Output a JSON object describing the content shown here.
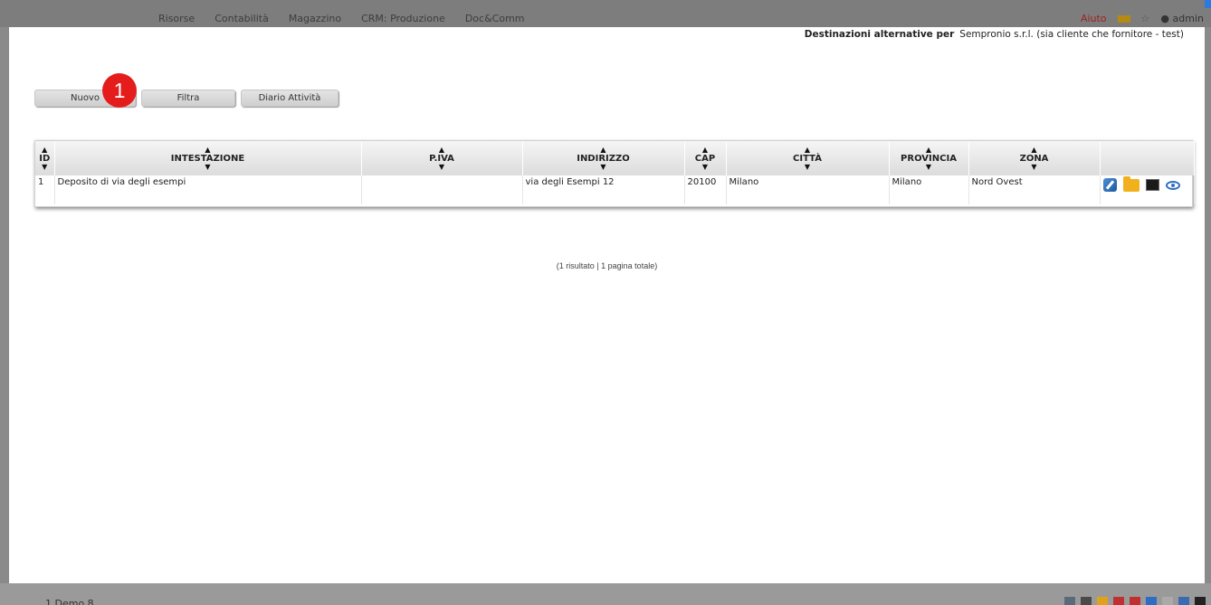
{
  "background": {
    "menu": [
      "Risorse",
      "Contabilità",
      "Magazzino",
      "CRM: Produzione",
      "Doc&Comm"
    ],
    "help": "Aiuto",
    "user": "admin",
    "bottom_text": "1   Demo 8"
  },
  "dialog": {
    "title_label": "Destinazioni alternative per",
    "title_value": "Sempronio s.r.l. (sia cliente che fornitore - test)"
  },
  "toolbar": {
    "nuovo": "Nuovo",
    "filtra": "Filtra",
    "diario": "Diario Attività"
  },
  "badge": "1",
  "table": {
    "columns": [
      "ID",
      "INTESTAZIONE",
      "P.IVA",
      "INDIRIZZO",
      "CAP",
      "CITTÀ",
      "PROVINCIA",
      "ZONA",
      ""
    ],
    "rows": [
      {
        "id": "1",
        "intestazione": "Deposito di via degli esempi",
        "piva": "",
        "indirizzo": "via degli Esempi 12",
        "cap": "20100",
        "citta": "Milano",
        "provincia": "Milano",
        "zona": "Nord Ovest"
      }
    ]
  },
  "result_text": "(1 risultato | 1 pagina totale)",
  "icons": {
    "edit": "pencil-edit-icon",
    "folder": "folder-icon",
    "terminal": "terminal-icon",
    "view": "eye-icon"
  }
}
